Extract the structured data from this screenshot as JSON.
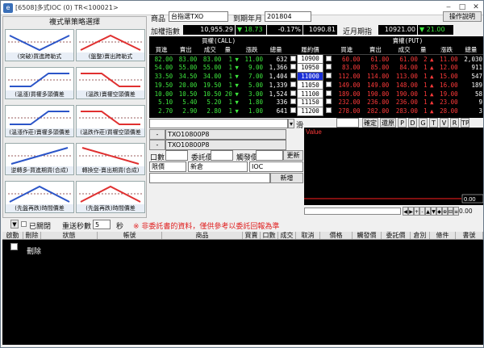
{
  "window": {
    "title": "[6508]多式IOC (0) TR<100021>"
  },
  "strategy_panel": {
    "title": "複式單策略選擇",
    "items": [
      {
        "label": "(突破)買進跨勒式",
        "icon": "buy-strangle-icon"
      },
      {
        "label": "(盤整)賣出跨勒式",
        "icon": "sell-strangle-icon"
      },
      {
        "label": "(溫漲)買權多頭價差",
        "icon": "bull-call-spread-icon"
      },
      {
        "label": "(溫跌)賣權空頭價差",
        "icon": "bear-put-spread-icon"
      },
      {
        "label": "(溫漲作莊)賣權多頭價差",
        "icon": "bull-put-spread-icon"
      },
      {
        "label": "(溫跌作莊)買權空頭價差",
        "icon": "bear-call-spread-icon"
      },
      {
        "label": "逆轉多-買進期貨(合成)",
        "icon": "synthetic-long-icon"
      },
      {
        "label": "轉換空-賣出期貨(合成)",
        "icon": "synthetic-short-icon"
      },
      {
        "label": "(先盤再跌)時間價差",
        "icon": "time-spread-call-icon"
      },
      {
        "label": "(先盤再跌)時間價差",
        "icon": "time-spread-put-icon"
      }
    ]
  },
  "topbar": {
    "product_label": "商品",
    "product_value": "台指選TXO",
    "expiry_label": "到期年月",
    "expiry_value": "201804",
    "help_button": "操作說明",
    "index_label": "加權指數",
    "index_value": "10,955.29",
    "index_change": "18.73",
    "index_pct": "-0.17%",
    "index_extra": "1090.81",
    "near_label": "近月期指",
    "near_value": "10921.00",
    "near_change": "21.00"
  },
  "quote": {
    "call_header": "買權(CALL)",
    "put_header": "賣權(PUT)",
    "call_cols": [
      "買進",
      "賣出",
      "成交",
      "量",
      "",
      "漲跌",
      "總量"
    ],
    "mid_cols": [
      "",
      "履約價",
      ""
    ],
    "put_cols": [
      "買進",
      "賣出",
      "成交",
      "量",
      "",
      "漲跌",
      "總量"
    ],
    "rows": [
      {
        "cb": "82.00",
        "cs": "83.00",
        "cd": "83.00",
        "cv": "1",
        "cc": "11.00",
        "ct": "632",
        "k": "10900",
        "pb": "60.00",
        "ps": "61.00",
        "pd": "61.00",
        "pv": "2",
        "pc": "11.00",
        "pt": "2,030"
      },
      {
        "cb": "54.00",
        "cs": "55.00",
        "cd": "55.00",
        "cv": "1",
        "cc": "9.00",
        "ct": "1,366",
        "k": "10950",
        "pb": "83.00",
        "ps": "85.00",
        "pd": "84.00",
        "pv": "1",
        "pc": "12.00",
        "pt": "911"
      },
      {
        "cb": "33.50",
        "cs": "34.50",
        "cd": "34.00",
        "cv": "1",
        "cc": "7.00",
        "ct": "1,404",
        "k": "11000",
        "pb": "112.00",
        "ps": "114.00",
        "pd": "113.00",
        "pv": "1",
        "pc": "15.00",
        "pt": "547"
      },
      {
        "cb": "19.50",
        "cs": "20.00",
        "cd": "19.50",
        "cv": "1",
        "cc": "5.00",
        "ct": "1,339",
        "k": "11050",
        "pb": "149.00",
        "ps": "149.00",
        "pd": "148.00",
        "pv": "1",
        "pc": "16.00",
        "pt": "189"
      },
      {
        "cb": "10.00",
        "cs": "10.50",
        "cd": "10.50",
        "cv": "20",
        "cc": "3.00",
        "ct": "1,524",
        "k": "11100",
        "pb": "189.00",
        "ps": "190.00",
        "pd": "190.00",
        "pv": "1",
        "pc": "19.00",
        "pt": "58"
      },
      {
        "cb": "5.10",
        "cs": "5.40",
        "cd": "5.20",
        "cv": "1",
        "cc": "1.80",
        "ct": "336",
        "k": "11150",
        "pb": "232.00",
        "ps": "236.00",
        "pd": "236.00",
        "pv": "1",
        "pc": "23.00",
        "pt": "9"
      },
      {
        "cb": "2.70",
        "cs": "2.90",
        "cd": "2.80",
        "cv": "1",
        "cc": "1.00",
        "ct": "641",
        "k": "11200",
        "pb": "278.00",
        "ps": "282.00",
        "pd": "283.00",
        "pv": "1",
        "pc": "28.00",
        "pt": "3"
      }
    ],
    "selected_strike": "11000"
  },
  "order": {
    "legs": [
      "TXO10800P8",
      "TXO10800P8"
    ],
    "qty_label": "口數",
    "price_label": "委託價",
    "trigger_label": "觸發價",
    "refresh_button": "更新",
    "price_type": "限價",
    "open_close": "新倉",
    "cond": "IOC",
    "new_button": "新增"
  },
  "chart": {
    "legend": "Value",
    "value": "0.00",
    "value2": "0.00",
    "controls": [
      "確定",
      "還原",
      "P",
      "D",
      "G",
      "T",
      "V",
      "R",
      "TP"
    ],
    "bar_buttons": [
      "◀",
      "▶",
      "+",
      "-",
      "▲",
      "▼",
      "◆",
      "⊕",
      "⊟",
      "≡"
    ]
  },
  "orders": {
    "closed_label": "已關閉",
    "reset_label": "重送秒數",
    "reset_value": "5",
    "sec_label": "秒",
    "notice": "※ 非委託書的資料，僅供參考以委託回報為準",
    "cols": [
      "啟動",
      "刪除",
      "狀態",
      "帳號",
      "商品",
      "買賣",
      "口數",
      "成交",
      "取消",
      "價格",
      "觸發價",
      "委託價",
      "倉別",
      "條件",
      "書號"
    ],
    "delete_label": "刪除"
  }
}
